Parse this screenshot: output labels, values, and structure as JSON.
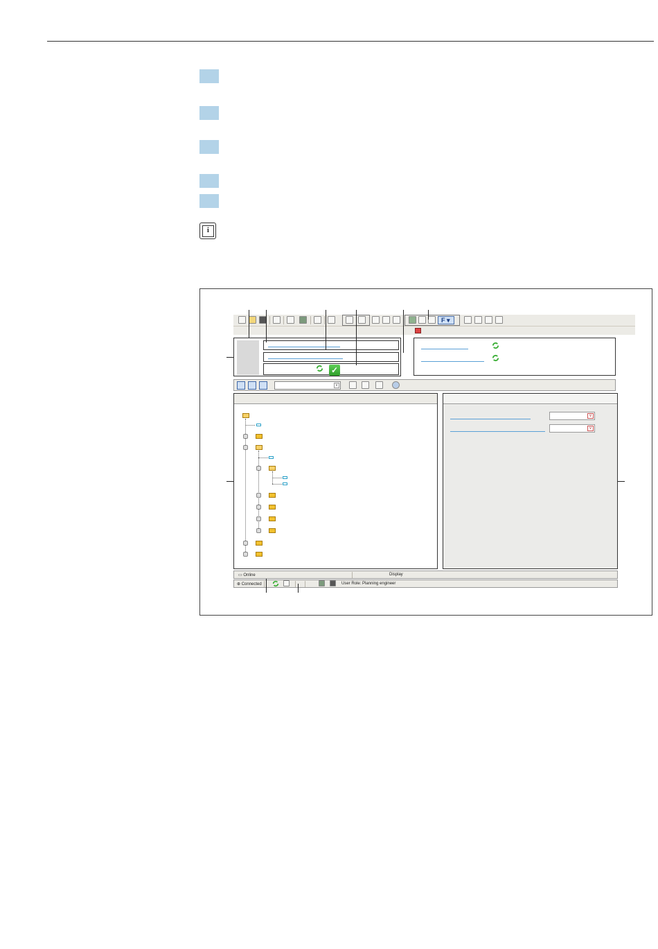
{
  "figure": {
    "tabbar": {
      "online_tab": "Online",
      "display_label": "Display"
    },
    "statusbar": {
      "connected": "Connected",
      "user_role": "User Role: Planning engineer"
    },
    "colors": {
      "step_marker": "#b3d3e8",
      "link_blue": "#5aa0d6",
      "folder_yellow": "#f2c12e",
      "check_green": "#3aae35"
    }
  }
}
